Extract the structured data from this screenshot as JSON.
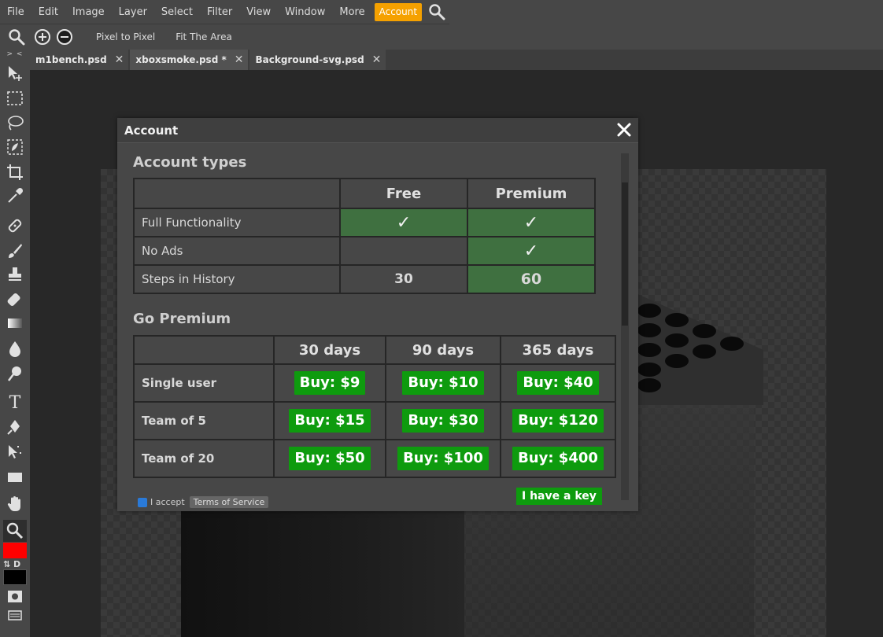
{
  "menu": {
    "items": [
      "File",
      "Edit",
      "Image",
      "Layer",
      "Select",
      "Filter",
      "View",
      "Window",
      "More"
    ],
    "account_label": "Account"
  },
  "options": {
    "pixel_to_pixel": "Pixel to Pixel",
    "fit_area": "Fit The Area"
  },
  "tabs": [
    {
      "label": "m1bench.psd"
    },
    {
      "label": "xboxsmoke.psd *"
    },
    {
      "label": "Background-svg.psd"
    }
  ],
  "toolbar": {
    "collapse": "> <",
    "swap_label": "⇅ D"
  },
  "colors": {
    "foreground": "#ff0000",
    "background": "#000000",
    "accent": "#f5a100",
    "buy_green": "#0e9b0e",
    "feature_green": "#3f7040"
  },
  "dialog": {
    "title": "Account",
    "account_types_title": "Account types",
    "types_header": [
      "",
      "Free",
      "Premium"
    ],
    "types_rows": [
      {
        "label": "Full Functionality",
        "free": "✓",
        "premium": "✓"
      },
      {
        "label": "No Ads",
        "free": "",
        "premium": "✓"
      },
      {
        "label": "Steps in History",
        "free": "30",
        "premium": "60"
      }
    ],
    "go_premium_title": "Go Premium",
    "premium_header": [
      "",
      "30 days",
      "90 days",
      "365 days"
    ],
    "premium_rows": [
      {
        "label": "Single user",
        "p30": "Buy: $9",
        "p90": "Buy: $10",
        "p365": "Buy: $40"
      },
      {
        "label": "Team of 5",
        "p30": "Buy: $15",
        "p90": "Buy: $30",
        "p365": "Buy: $120"
      },
      {
        "label": "Team of 20",
        "p30": "Buy: $50",
        "p90": "Buy: $100",
        "p365": "Buy: $400"
      }
    ],
    "accept_label": "I accept",
    "tos_label": "Terms of Service",
    "key_button": "I have a key"
  }
}
